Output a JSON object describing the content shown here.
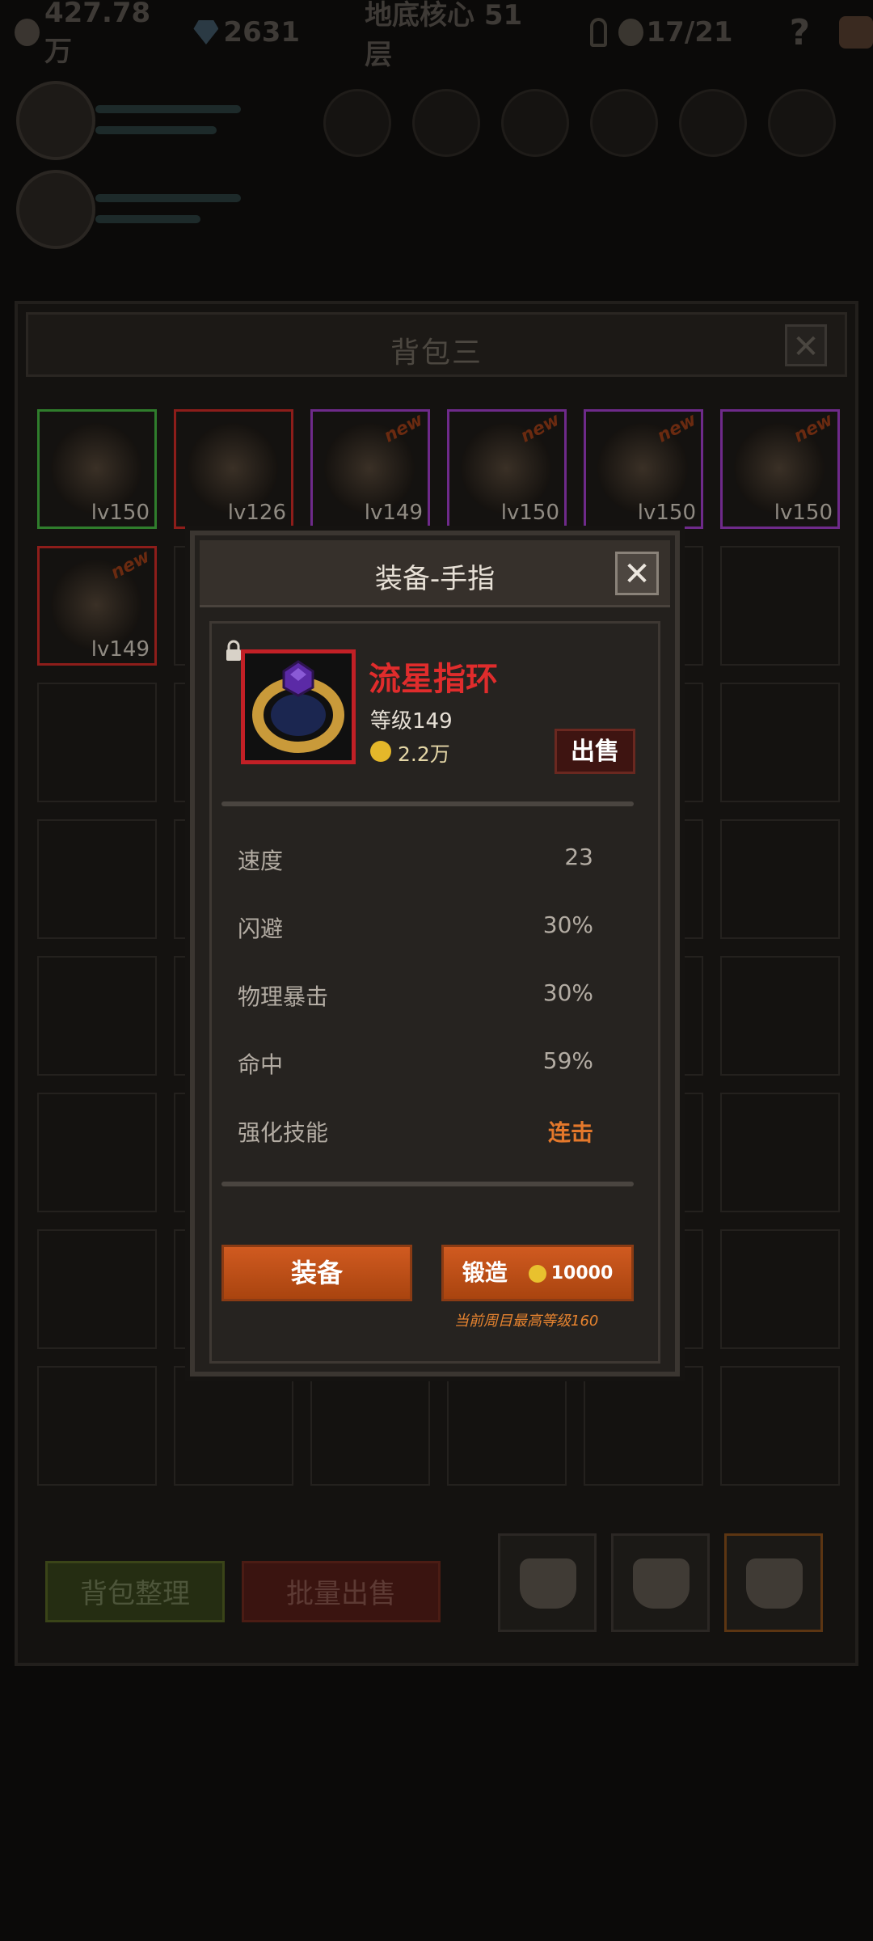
{
  "topbar": {
    "gold": "427.78万",
    "gems": "2631",
    "floor": "地底核心 51层",
    "progress": "17/21",
    "help": "?"
  },
  "bag": {
    "title": "背包三",
    "close": "✕",
    "items": [
      {
        "level": "lv150",
        "is_new": false,
        "rarity_color": "#2f7d2c",
        "icon": "golden-wing-helmet"
      },
      {
        "level": "lv126",
        "is_new": false,
        "rarity_color": "#8d1d1a",
        "icon": "green-blade"
      },
      {
        "level": "lv149",
        "is_new": true,
        "rarity_color": "#6e2a8a",
        "icon": "magic-orb"
      },
      {
        "level": "lv150",
        "is_new": true,
        "rarity_color": "#6e2a8a",
        "icon": "feather-dagger"
      },
      {
        "level": "lv150",
        "is_new": true,
        "rarity_color": "#6e2a8a",
        "icon": "sword"
      },
      {
        "level": "lv150",
        "is_new": true,
        "rarity_color": "#6e2a8a",
        "icon": "dark-armor"
      },
      {
        "level": "lv149",
        "is_new": true,
        "rarity_color": "#8d1d1a",
        "icon": "ring"
      }
    ],
    "new_tag": "new",
    "tidy_button": "背包整理",
    "batch_sell_button": "批量出售"
  },
  "dialog": {
    "title": "装备-手指",
    "close": "✕",
    "item_name": "流星指环",
    "item_level": "等级149",
    "price": "2.2万",
    "sell_button": "出售",
    "stats": [
      {
        "label": "速度",
        "value": "23"
      },
      {
        "label": "闪避",
        "value": "30%"
      },
      {
        "label": "物理暴击",
        "value": "30%"
      },
      {
        "label": "命中",
        "value": "59%"
      },
      {
        "label": "强化技能",
        "value": "连击"
      }
    ],
    "equip_button": "装备",
    "forge_button": "锻造",
    "forge_cost": "10000",
    "max_level_note": "当前周目最高等级160"
  }
}
